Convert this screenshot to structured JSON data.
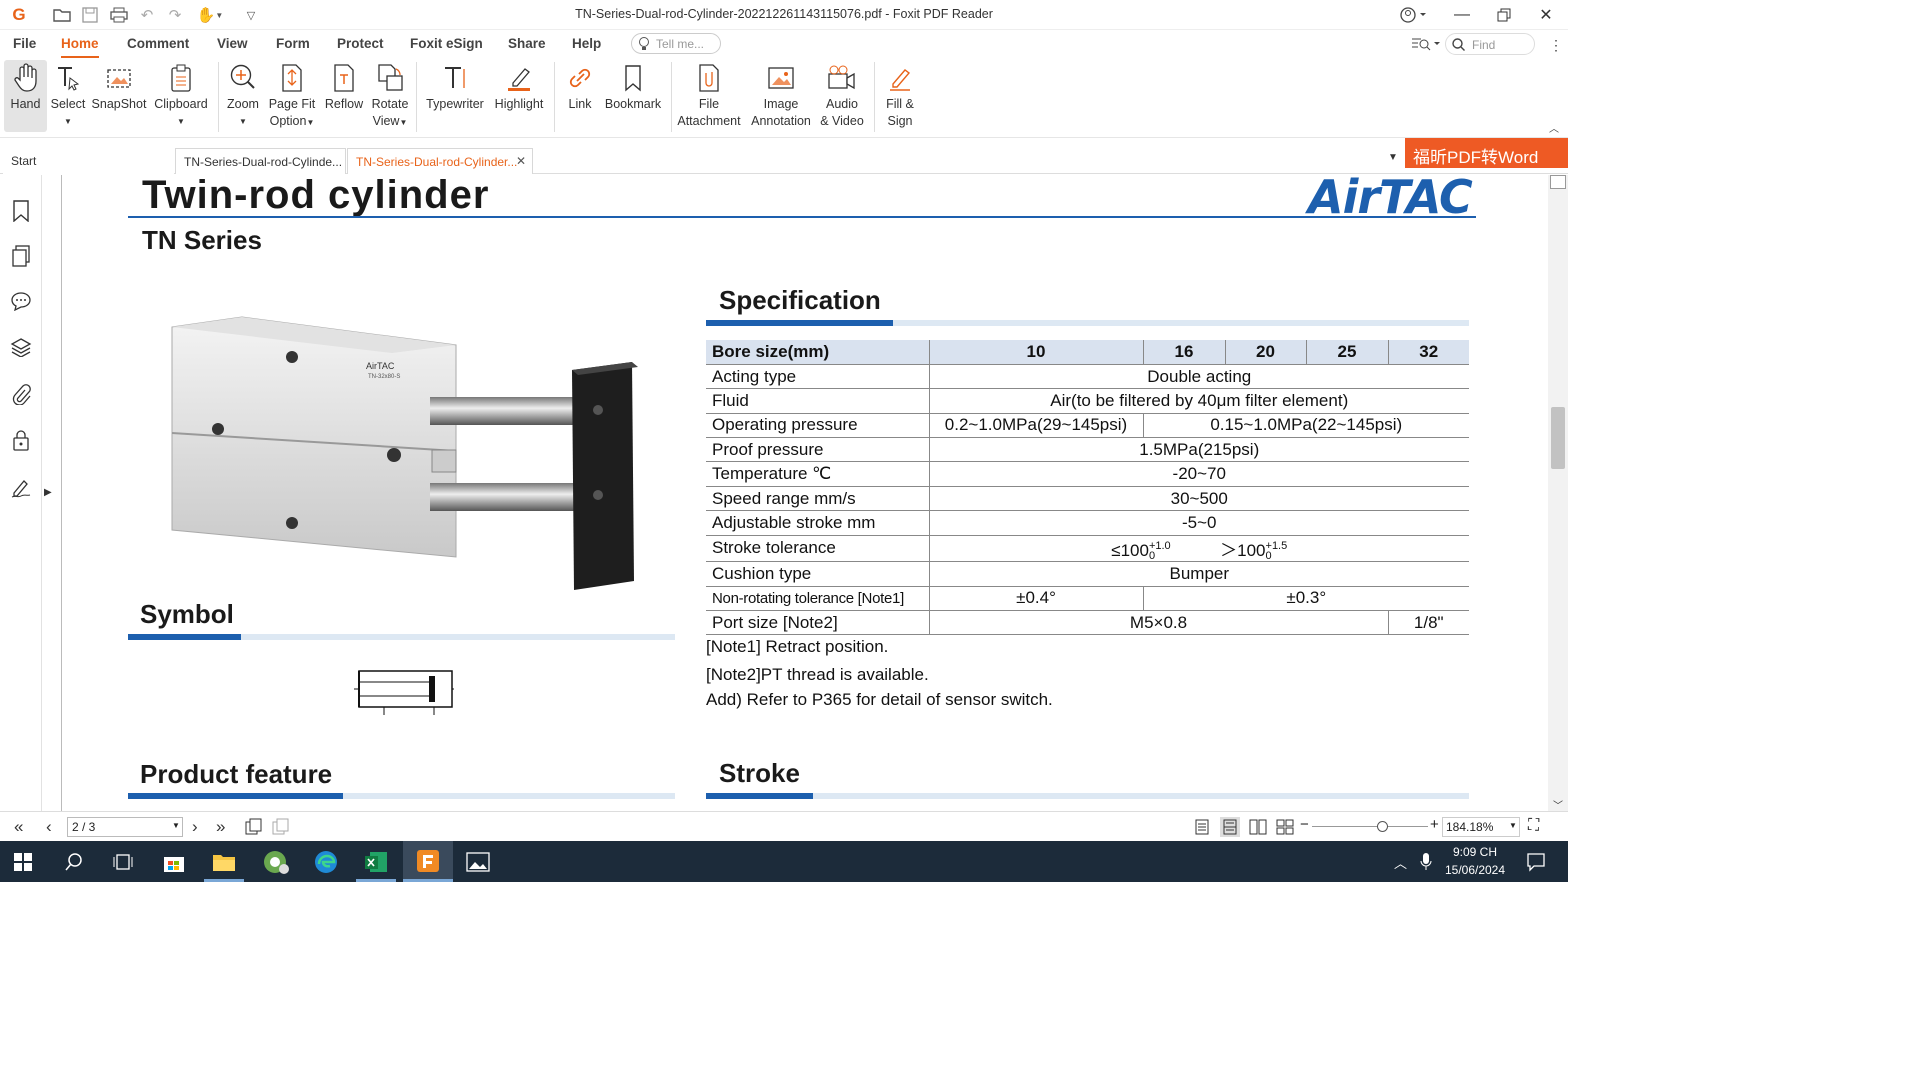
{
  "window": {
    "title": "TN-Series-Dual-rod-Cylinder-202212261143115076.pdf - Foxit PDF Reader"
  },
  "menu": {
    "tabs": [
      "File",
      "Home",
      "Comment",
      "View",
      "Form",
      "Protect",
      "Foxit eSign",
      "Share",
      "Help"
    ],
    "active": "Home",
    "tell_me_placeholder": "Tell me...",
    "find_placeholder": "Find"
  },
  "ribbon": {
    "hand": "Hand",
    "select": "Select",
    "snapshot": "SnapShot",
    "clipboard": "Clipboard",
    "zoom": "Zoom",
    "pagefit_1": "Page Fit",
    "pagefit_2": "Option",
    "reflow": "Reflow",
    "rotate_1": "Rotate",
    "rotate_2": "View",
    "typewriter": "Typewriter",
    "highlight": "Highlight",
    "link": "Link",
    "bookmark": "Bookmark",
    "fileatt_1": "File",
    "fileatt_2": "Attachment",
    "imgann_1": "Image",
    "imgann_2": "Annotation",
    "audio_1": "Audio",
    "audio_2": "& Video",
    "fill_1": "Fill &",
    "fill_2": "Sign"
  },
  "doc_tabs": {
    "start": "Start",
    "tab1": "TN-Series-Dual-rod-Cylinde...",
    "tab2": "TN-Series-Dual-rod-Cylinder..."
  },
  "promo": "福昕PDF转Word",
  "document": {
    "title": "Twin-rod cylinder",
    "series": "TN Series",
    "logo": "AirTAC",
    "product_label": "AirTAC",
    "product_model": "TN-32x80-S",
    "spec_heading": "Specification",
    "symbol_heading": "Symbol",
    "feature_heading": "Product feature",
    "stroke_heading": "Stroke",
    "spec": {
      "bore_label": "Bore size(mm)",
      "bores": [
        "10",
        "16",
        "20",
        "25",
        "32"
      ],
      "acting_label": "Acting type",
      "acting": "Double acting",
      "fluid_label": "Fluid",
      "fluid": "Air(to be filtered by 40μm filter element)",
      "op_label": "Operating pressure",
      "op_a": "0.2~1.0MPa(29~145psi)",
      "op_b": "0.15~1.0MPa(22~145psi)",
      "proof_label": "Proof pressure",
      "proof": "1.5MPa(215psi)",
      "temp_label": "Temperature ℃",
      "temp": "-20~70",
      "speed_label": "Speed range mm/s",
      "speed": "30~500",
      "adj_label": "Adjustable stroke mm",
      "adj": "-5~0",
      "tol_label": "Stroke tolerance",
      "tol_a": "≤100",
      "tol_a_sup": "+1.0",
      "tol_a_sub": "0",
      "tol_b": "＞100",
      "tol_b_sup": "+1.5",
      "tol_b_sub": "0",
      "cushion_label": "Cushion type",
      "cushion": "Bumper",
      "nonrot_label": "Non-rotating tolerance [Note1]",
      "nonrot_a": "±0.4°",
      "nonrot_b": "±0.3°",
      "port_label": "Port size [Note2]",
      "port_a": "M5×0.8",
      "port_b": "1/8\""
    },
    "notes": [
      "[Note1] Retract position.",
      "[Note2]PT thread is available.",
      "Add) Refer to P365 for detail of sensor switch."
    ]
  },
  "status": {
    "page": "2 / 3",
    "zoom": "184.18%",
    "zoom_fraction": 0.62
  },
  "taskbar": {
    "time": "9:09 CH",
    "date": "15/06/2024"
  }
}
